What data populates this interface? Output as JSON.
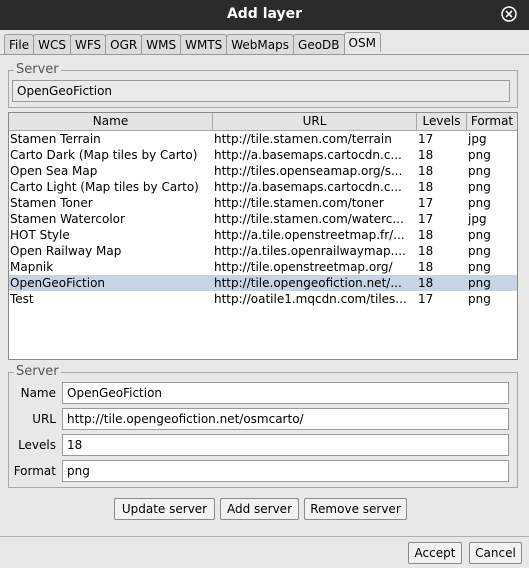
{
  "window": {
    "title": "Add layer"
  },
  "tabs": [
    "File",
    "WCS",
    "WFS",
    "OGR",
    "WMS",
    "WMTS",
    "WebMaps",
    "GeoDB",
    "OSM"
  ],
  "active_tab": "OSM",
  "server_top": {
    "label": "Server",
    "value": "OpenGeoFiction"
  },
  "table": {
    "headers": [
      "Name",
      "URL",
      "Levels",
      "Format"
    ],
    "rows": [
      [
        "Stamen Terrain",
        "http://tile.stamen.com/terrain",
        "17",
        "jpg"
      ],
      [
        "Carto Dark (Map tiles by Carto)",
        "http://a.basemaps.cartocdn.c...",
        "18",
        "png"
      ],
      [
        "Open Sea Map",
        "http://tiles.openseamap.org/s...",
        "18",
        "png"
      ],
      [
        "Carto Light (Map tiles by Carto)",
        "http://a.basemaps.cartocdn.c...",
        "18",
        "png"
      ],
      [
        "Stamen Toner",
        "http://tile.stamen.com/toner",
        "17",
        "png"
      ],
      [
        "Stamen Watercolor",
        "http://tile.stamen.com/waterc...",
        "17",
        "jpg"
      ],
      [
        "HOT Style",
        "http://a.tile.openstreetmap.fr/...",
        "18",
        "png"
      ],
      [
        "Open Railway Map",
        "http://a.tiles.openrailwaymap....",
        "18",
        "png"
      ],
      [
        "Mapnik",
        "http://tile.openstreetmap.org/",
        "18",
        "png"
      ],
      [
        "OpenGeoFiction",
        "http://tile.opengeofiction.net/...",
        "18",
        "png"
      ],
      [
        "Test",
        "http://oatile1.mqcdn.com/tiles...",
        "17",
        "png"
      ]
    ],
    "selected_index": 9
  },
  "server_form": {
    "label": "Server",
    "name_label": "Name",
    "name_value": "OpenGeoFiction",
    "url_label": "URL",
    "url_value": "http://tile.opengeofiction.net/osmcarto/",
    "levels_label": "Levels",
    "levels_value": "18",
    "format_label": "Format",
    "format_value": "png"
  },
  "buttons": {
    "update": "Update server",
    "add": "Add server",
    "remove": "Remove server",
    "accept": "Accept",
    "cancel": "Cancel"
  }
}
